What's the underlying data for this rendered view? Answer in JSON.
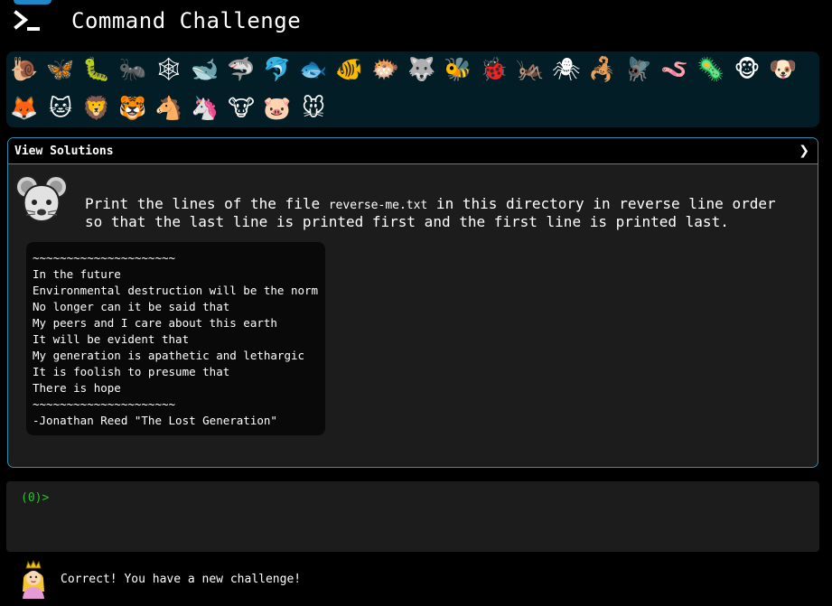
{
  "app": {
    "title": "Command Challenge",
    "logo_icon": "terminal-prompt-icon"
  },
  "animals": {
    "row1": [
      {
        "name": "snail",
        "glyph": "🐌"
      },
      {
        "name": "butterfly",
        "glyph": "🦋"
      },
      {
        "name": "caterpillar",
        "glyph": "🐛"
      },
      {
        "name": "ant",
        "glyph": "🐜"
      },
      {
        "name": "spider-web",
        "glyph": "🕸"
      },
      {
        "name": "whale",
        "glyph": "🐋"
      },
      {
        "name": "shark",
        "glyph": "🦈"
      },
      {
        "name": "dolphin",
        "glyph": "🐬"
      },
      {
        "name": "fish",
        "glyph": "🐟"
      },
      {
        "name": "tropical-fish",
        "glyph": "🐠"
      },
      {
        "name": "blowfish",
        "glyph": "🐡"
      },
      {
        "name": "wolf",
        "glyph": "🐺"
      },
      {
        "name": "bee",
        "glyph": "🐝"
      },
      {
        "name": "ladybug",
        "glyph": "🐞"
      },
      {
        "name": "cricket",
        "glyph": "🦗"
      },
      {
        "name": "spider",
        "glyph": "🕷"
      },
      {
        "name": "scorpion",
        "glyph": "🦂"
      },
      {
        "name": "fly",
        "glyph": "🪰"
      },
      {
        "name": "worm",
        "glyph": "🪱"
      },
      {
        "name": "microbe",
        "glyph": "🦠"
      },
      {
        "name": "monkey",
        "glyph": "🐵"
      },
      {
        "name": "dog",
        "glyph": "🐶"
      }
    ],
    "row2": [
      {
        "name": "fox",
        "glyph": "🦊"
      },
      {
        "name": "cat",
        "glyph": "🐱"
      },
      {
        "name": "lion",
        "glyph": "🦁"
      },
      {
        "name": "tiger",
        "glyph": "🐯"
      },
      {
        "name": "horse",
        "glyph": "🐴"
      },
      {
        "name": "unicorn",
        "glyph": "🦄"
      },
      {
        "name": "cow",
        "glyph": "🐮"
      },
      {
        "name": "pig",
        "glyph": "🐷"
      },
      {
        "name": "mouse",
        "glyph": "🐭"
      }
    ]
  },
  "challenge": {
    "view_solutions": "View Solutions",
    "chevron": "❯",
    "avatar_icon": "mouse-face-icon",
    "prompt_before": "Print the lines of the file ",
    "prompt_file": "reverse-me.txt",
    "prompt_after": " in this directory in reverse line order so that the last line is printed first and the first line is printed last.",
    "file_lines": [
      "~~~~~~~~~~~~~~~~~~~~~",
      "In the future",
      "Environmental destruction will be the norm",
      "No longer can it be said that",
      "My peers and I care about this earth",
      "It will be evident that",
      "My generation is apathetic and lethargic",
      "It is foolish to presume that",
      "There is hope",
      "~~~~~~~~~~~~~~~~~~~~~",
      "-Jonathan Reed \"The Lost Generation\""
    ]
  },
  "terminal": {
    "prompt": "(0)>"
  },
  "status": {
    "message": "Correct! You have a new challenge!",
    "avatar_icon": "princess-icon"
  },
  "colors": {
    "accent": "#2b8fb3",
    "animals_bg": "#031d26",
    "panel_bg": "#1c1c1c",
    "prompt_green": "#2cc12c"
  }
}
